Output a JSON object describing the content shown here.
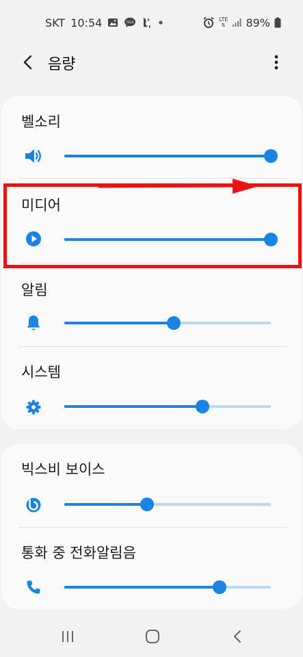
{
  "status_bar": {
    "carrier": "SKT",
    "time": "10:54",
    "network": "LTE",
    "battery": "89%",
    "icons": [
      "gallery-icon",
      "talk-icon",
      "bird-icon",
      "dot-icon",
      "alarm-icon",
      "signal-icon",
      "battery-icon"
    ]
  },
  "app_bar": {
    "title": "음량",
    "back_icon": "chevron-left-icon",
    "more_icon": "more-vertical-icon"
  },
  "colors": {
    "accent": "#1b84e3",
    "track": "#b9d8f3",
    "highlight": "#ee1111",
    "background": "#f2f2f2",
    "card": "#fafafa"
  },
  "volume_groups": [
    {
      "items": [
        {
          "label": "벨소리",
          "icon": "speaker-icon",
          "level": 1.0
        },
        {
          "label": "미디어",
          "icon": "play-icon",
          "level": 1.0
        },
        {
          "label": "알림",
          "icon": "bell-icon",
          "level": 0.53
        },
        {
          "label": "시스템",
          "icon": "gear-icon",
          "level": 0.67
        }
      ]
    },
    {
      "items": [
        {
          "label": "빅스비 보이스",
          "icon": "bixby-icon",
          "level": 0.4
        },
        {
          "label": "통화 중 전화알림음",
          "icon": "phone-icon",
          "level": 0.75
        }
      ]
    }
  ],
  "nav_bar": {
    "buttons": [
      "recents-icon",
      "home-icon",
      "back-icon"
    ]
  }
}
